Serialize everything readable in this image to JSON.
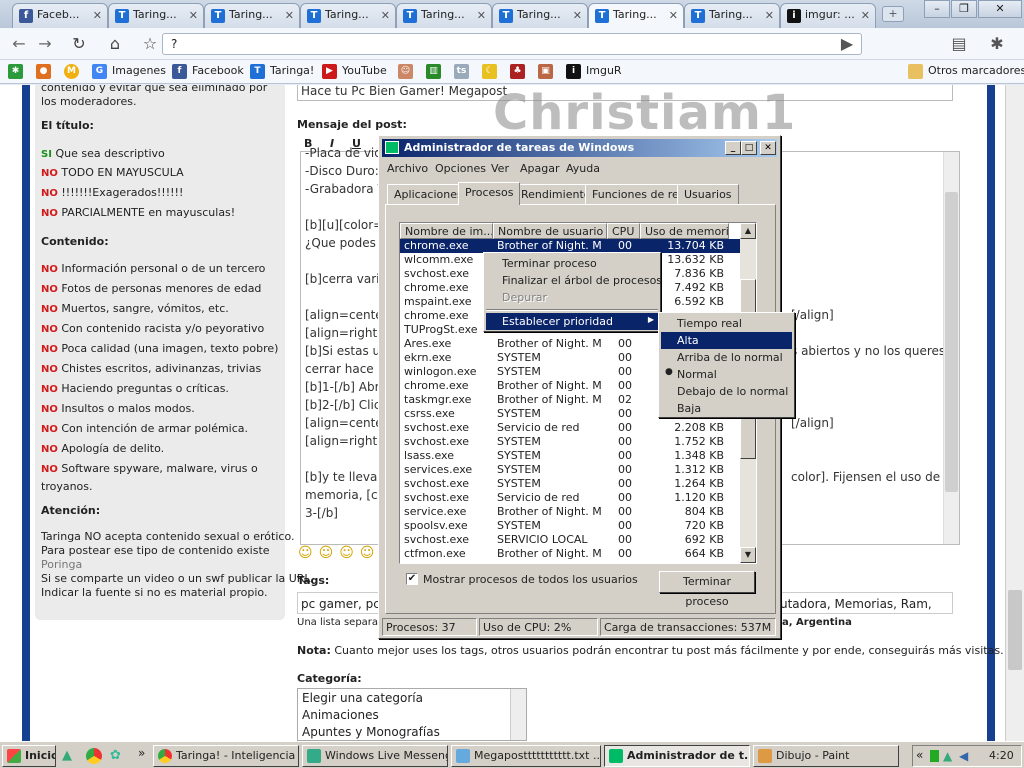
{
  "browser": {
    "tabs": [
      {
        "label": "Faceb...",
        "icon": "facebook-icon",
        "color": "#3b5998"
      },
      {
        "label": "Taring...",
        "icon": "taringa-icon",
        "color": "#1e6fd6"
      },
      {
        "label": "Taring...",
        "icon": "taringa-icon",
        "color": "#1e6fd6"
      },
      {
        "label": "Taring...",
        "icon": "taringa-icon",
        "color": "#1e6fd6"
      },
      {
        "label": "Taring...",
        "icon": "taringa-icon",
        "color": "#1e6fd6"
      },
      {
        "label": "Taring...",
        "icon": "taringa-icon",
        "color": "#1e6fd6"
      },
      {
        "label": "Taring...",
        "icon": "taringa-icon",
        "color": "#1e6fd6"
      },
      {
        "label": "Taring...",
        "icon": "taringa-icon",
        "color": "#1e6fd6"
      },
      {
        "label": "imgur: ...",
        "icon": "imgur-icon",
        "color": "#111111"
      }
    ],
    "address": "?",
    "bookmarks": [
      "Imagenes",
      "Facebook",
      "Taringa!",
      "YouTube",
      "ImguR"
    ],
    "other_bookmarks": "Otros marcadores"
  },
  "rules": {
    "intro": "contenido y evitar que sea eliminado por los moderadores.",
    "title_heading": "El título:",
    "title_rules": [
      {
        "tag": "SI",
        "text": "Que sea descriptivo"
      },
      {
        "tag": "NO",
        "text": "TODO EN MAYUSCULA"
      },
      {
        "tag": "NO",
        "text": "!!!!!!!Exagerados!!!!!!"
      },
      {
        "tag": "NO",
        "text": "PARCIALMENTE en mayusculas!"
      }
    ],
    "content_heading": "Contenido:",
    "content_rules": [
      "Información personal o de un tercero",
      "Fotos de personas menores de edad",
      "Muertos, sangre, vómitos, etc.",
      "Con contenido racista y/o peyorativo",
      "Poca calidad (una imagen, texto pobre)",
      "Chistes escritos, adivinanzas, trivias",
      "Haciendo preguntas o críticas.",
      "Insultos o malos modos.",
      "Con intención de armar polémica.",
      "Apología de delito.",
      "Software spyware, malware, virus o"
    ],
    "content_rules_tail": "troyanos.",
    "no_tag": "NO",
    "attention_heading": "Atención:",
    "attention_lines": [
      "Taringa NO acepta contenido sexual o erótico.",
      "Para postear ese tipo de contenido existe",
      "Poringa",
      "Si se comparte un video o un swf publicar la URL",
      "Indicar la fuente si no es material propio."
    ]
  },
  "post": {
    "title_value": "Hace tu Pc Bien Gamer! Megapost",
    "message_label": "Mensaje del post:",
    "watermark": "Christiam1",
    "editor_lines": [
      "-Placa de vid",
      "-Disco Duro: 7",
      "-Grabadora Vc",
      "",
      "[b][u][color=",
      "¿Que podes a",
      "",
      "[b]cerra vario",
      "",
      "[align=center",
      "[align=right][",
      "[b]Si estas us",
      "cerrar hace lo",
      "[b]1-[/b] Abr",
      "[b]2-[/b] Click",
      "[align=center",
      "[align=right][",
      "",
      "[b]y te lleva a",
      "memoria, [col",
      "3-[/b]"
    ],
    "editor_right": [
      "[/align]",
      "s abiertos y no los queres",
      "[/align]",
      "color]. Fijensen el uso de la"
    ],
    "tags_label": "Tags:",
    "tags_value": "pc gamer, pc,",
    "tags_right": "utadora, Memorias, Ram,",
    "tags_hint": "Una lista separada",
    "tags_hint_right": "a, Argentina",
    "note_label": "Nota:",
    "note_text": "Cuanto mejor uses los tags, otros usuarios podrán encontrar tu post más fácilmente y por ende, conseguirás más visitas.",
    "category_label": "Categoría:",
    "categories": [
      "Elegir una categoría",
      "Animaciones",
      "Apuntes y Monografías"
    ]
  },
  "taskmgr": {
    "title": "Administrador de tareas de Windows",
    "menu": [
      "Archivo",
      "Opciones",
      "Ver",
      "Apagar",
      "Ayuda"
    ],
    "tabs": [
      "Aplicaciones",
      "Procesos",
      "Rendimiento",
      "Funciones de red",
      "Usuarios"
    ],
    "columns": [
      "Nombre de im...",
      "Nombre de usuario",
      "CPU",
      "Uso de memoria"
    ],
    "processes": [
      {
        "name": "chrome.exe",
        "user": "Brother of Night. M",
        "cpu": "00",
        "mem": "13.704 KB"
      },
      {
        "name": "wlcomm.exe",
        "user": "",
        "cpu": "",
        "mem": "13.632 KB"
      },
      {
        "name": "svchost.exe",
        "user": "",
        "cpu": "",
        "mem": "7.836 KB"
      },
      {
        "name": "chrome.exe",
        "user": "",
        "cpu": "",
        "mem": "7.492 KB"
      },
      {
        "name": "mspaint.exe",
        "user": "",
        "cpu": "",
        "mem": "6.592 KB"
      },
      {
        "name": "chrome.exe",
        "user": "",
        "cpu": "",
        "mem": ""
      },
      {
        "name": "TUProgSt.exe",
        "user": "",
        "cpu": "",
        "mem": ""
      },
      {
        "name": "Ares.exe",
        "user": "Brother of Night. M",
        "cpu": "00",
        "mem": ""
      },
      {
        "name": "ekrn.exe",
        "user": "SYSTEM",
        "cpu": "00",
        "mem": ""
      },
      {
        "name": "winlogon.exe",
        "user": "SYSTEM",
        "cpu": "00",
        "mem": ""
      },
      {
        "name": "chrome.exe",
        "user": "Brother of Night. M",
        "cpu": "00",
        "mem": ""
      },
      {
        "name": "taskmgr.exe",
        "user": "Brother of Night. M",
        "cpu": "02",
        "mem": ""
      },
      {
        "name": "csrss.exe",
        "user": "SYSTEM",
        "cpu": "00",
        "mem": ""
      },
      {
        "name": "svchost.exe",
        "user": "Servicio de red",
        "cpu": "00",
        "mem": "2.208 KB"
      },
      {
        "name": "svchost.exe",
        "user": "SYSTEM",
        "cpu": "00",
        "mem": "1.752 KB"
      },
      {
        "name": "lsass.exe",
        "user": "SYSTEM",
        "cpu": "00",
        "mem": "1.348 KB"
      },
      {
        "name": "services.exe",
        "user": "SYSTEM",
        "cpu": "00",
        "mem": "1.312 KB"
      },
      {
        "name": "svchost.exe",
        "user": "SYSTEM",
        "cpu": "00",
        "mem": "1.264 KB"
      },
      {
        "name": "svchost.exe",
        "user": "Servicio de red",
        "cpu": "00",
        "mem": "1.120 KB"
      },
      {
        "name": "service.exe",
        "user": "Brother of Night. M",
        "cpu": "00",
        "mem": "804 KB"
      },
      {
        "name": "spoolsv.exe",
        "user": "SYSTEM",
        "cpu": "00",
        "mem": "720 KB"
      },
      {
        "name": "svchost.exe",
        "user": "SERVICIO LOCAL",
        "cpu": "00",
        "mem": "692 KB"
      },
      {
        "name": "ctfmon.exe",
        "user": "Brother of Night. M",
        "cpu": "00",
        "mem": "664 KB"
      }
    ],
    "show_all_label": "Mostrar procesos de todos los usuarios",
    "end_process_button": "Terminar proceso",
    "status": {
      "processes": "Procesos: 37",
      "cpu": "Uso de CPU: 2%",
      "commit": "Carga de transacciones: 537M"
    },
    "context_menu": [
      "Terminar proceso",
      "Finalizar el árbol de procesos",
      "Depurar",
      "Establecer prioridad"
    ],
    "priority_menu": [
      "Tiempo real",
      "Alta",
      "Arriba de lo normal",
      "Normal",
      "Debajo de lo normal",
      "Baja"
    ]
  },
  "taskbar": {
    "start": "Inicio",
    "buttons": [
      "Taringa! - Inteligencia ...",
      "Windows Live Messenger",
      "Megaposttttttttttt.txt ...",
      "Administrador de t...",
      "Dibujo - Paint"
    ],
    "clock": "4:20"
  }
}
